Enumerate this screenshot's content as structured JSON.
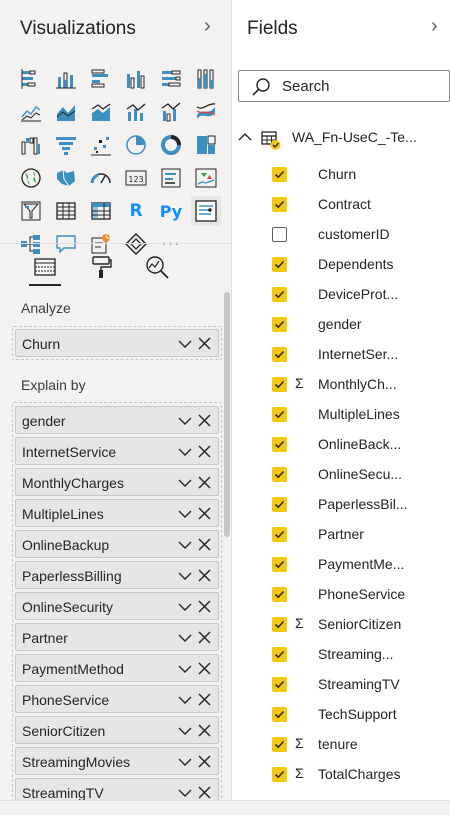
{
  "visualizations": {
    "title": "Visualizations",
    "icons": [
      "stacked-bar-chart-icon",
      "stacked-column-chart-icon",
      "clustered-bar-chart-icon",
      "clustered-column-chart-icon",
      "100-stacked-bar-chart-icon",
      "100-stacked-column-chart-icon",
      "line-chart-icon",
      "area-chart-icon",
      "stacked-area-chart-icon",
      "line-and-stacked-column-chart-icon",
      "line-and-clustered-column-chart-icon",
      "ribbon-chart-icon",
      "waterfall-chart-icon",
      "funnel-chart-icon",
      "scatter-chart-icon",
      "pie-chart-icon",
      "donut-chart-icon",
      "treemap-icon",
      "map-icon",
      "filled-map-icon",
      "gauge-icon",
      "card-icon",
      "multi-row-card-icon",
      "kpi-icon",
      "slicer-icon",
      "table-icon",
      "matrix-icon",
      "r-visual-icon",
      "python-visual-icon",
      "key-influencers-icon",
      "decomposition-tree-icon",
      "qa-icon",
      "smart-narrative-icon",
      "power-apps-icon",
      "more-visuals-icon"
    ],
    "r_glyph": "R",
    "py_glyph": "Py",
    "more_glyph": "···",
    "tabs": [
      "fields-tab-icon",
      "format-tab-icon",
      "analytics-tab-icon"
    ],
    "analyze_label": "Analyze",
    "analyze_field": "Churn",
    "explain_label": "Explain by",
    "explain_fields": [
      "gender",
      "InternetService",
      "MonthlyCharges",
      "MultipleLines",
      "OnlineBackup",
      "PaperlessBilling",
      "OnlineSecurity",
      "Partner",
      "PaymentMethod",
      "PhoneService",
      "SeniorCitizen",
      "StreamingMovies",
      "StreamingTV"
    ]
  },
  "fields": {
    "title": "Fields",
    "search_placeholder": "Search",
    "table_name": "WA_Fn-UseC_-Te...",
    "items": [
      {
        "label": "Churn",
        "checked": true,
        "sigma": false
      },
      {
        "label": "Contract",
        "checked": true,
        "sigma": false
      },
      {
        "label": "customerID",
        "checked": false,
        "sigma": false
      },
      {
        "label": "Dependents",
        "checked": true,
        "sigma": false
      },
      {
        "label": "DeviceProt...",
        "checked": true,
        "sigma": false
      },
      {
        "label": "gender",
        "checked": true,
        "sigma": false
      },
      {
        "label": "InternetSer...",
        "checked": true,
        "sigma": false
      },
      {
        "label": "MonthlyCh...",
        "checked": true,
        "sigma": true
      },
      {
        "label": "MultipleLines",
        "checked": true,
        "sigma": false
      },
      {
        "label": "OnlineBack...",
        "checked": true,
        "sigma": false
      },
      {
        "label": "OnlineSecu...",
        "checked": true,
        "sigma": false
      },
      {
        "label": "PaperlessBil...",
        "checked": true,
        "sigma": false
      },
      {
        "label": "Partner",
        "checked": true,
        "sigma": false
      },
      {
        "label": "PaymentMe...",
        "checked": true,
        "sigma": false
      },
      {
        "label": "PhoneService",
        "checked": true,
        "sigma": false
      },
      {
        "label": "SeniorCitizen",
        "checked": true,
        "sigma": true
      },
      {
        "label": "Streaming...",
        "checked": true,
        "sigma": false
      },
      {
        "label": "StreamingTV",
        "checked": true,
        "sigma": false
      },
      {
        "label": "TechSupport",
        "checked": true,
        "sigma": false
      },
      {
        "label": "tenure",
        "checked": true,
        "sigma": true
      },
      {
        "label": "TotalCharges",
        "checked": true,
        "sigma": true
      }
    ],
    "sigma_glyph": "Σ"
  },
  "colors": {
    "accent_yellow": "#f2c811",
    "pane_bg": "#f3f2f1",
    "icon_blue": "#118dff",
    "icon_teal": "#3c8fbf"
  }
}
